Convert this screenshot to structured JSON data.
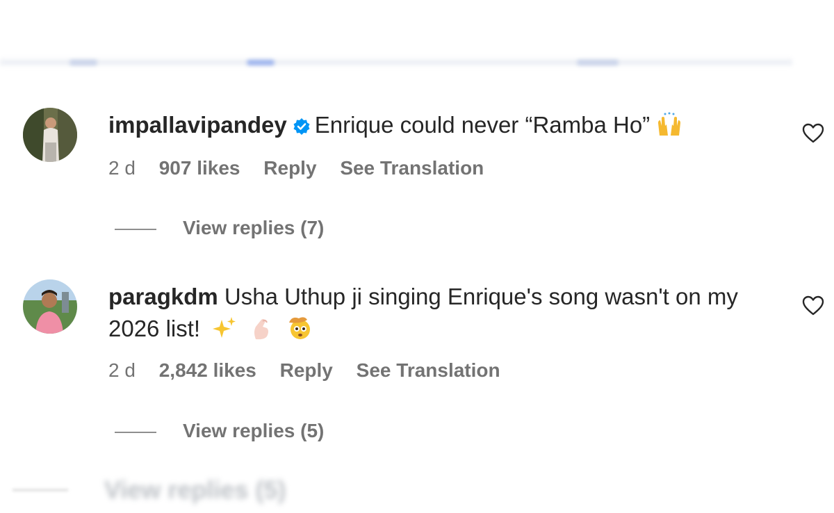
{
  "comments": [
    {
      "username": "impallavipandey",
      "verified": true,
      "text": "Enrique could never “Ramba Ho”",
      "emojis": [
        "raising-hands-emoji"
      ],
      "time": "2 d",
      "likes": "907 likes",
      "reply_label": "Reply",
      "translate_label": "See Translation",
      "view_replies": "View replies (7)"
    },
    {
      "username": "paragkdm",
      "verified": false,
      "text_line1": "Usha Uthup ji singing Enrique's song wasn't on my",
      "text_line2": "2026 list!",
      "emojis": [
        "sparkles-emoji",
        "finger-heart-emoji",
        "cowboy-face-emoji"
      ],
      "time": "2 d",
      "likes": "2,842 likes",
      "reply_label": "Reply",
      "translate_label": "See Translation",
      "view_replies": "View replies (5)"
    }
  ],
  "ghost_text": "View replies (5)",
  "colors": {
    "text": "#262626",
    "secondary": "#737373",
    "verified_blue": "#0095f6"
  }
}
